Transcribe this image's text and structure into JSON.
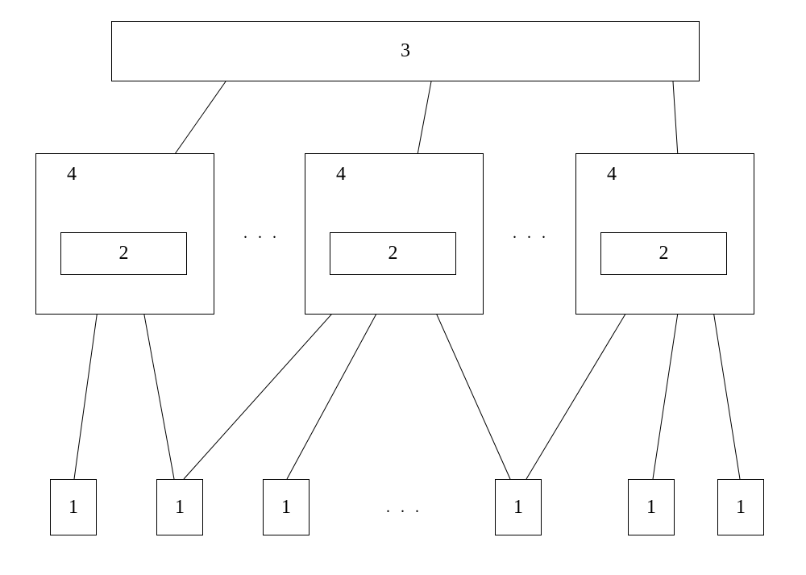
{
  "chart_data": {
    "type": "diagram",
    "title": "",
    "description": "Hierarchical tree / network diagram with three levels",
    "nodes": [
      {
        "id": "top",
        "label": "3",
        "level": 0
      },
      {
        "id": "container_a",
        "label": "4",
        "level": 1
      },
      {
        "id": "container_b",
        "label": "4",
        "level": 1
      },
      {
        "id": "container_c",
        "label": "4",
        "level": 1
      },
      {
        "id": "inner_a",
        "label": "2",
        "level": 1,
        "parent": "container_a"
      },
      {
        "id": "inner_b",
        "label": "2",
        "level": 1,
        "parent": "container_b"
      },
      {
        "id": "inner_c",
        "label": "2",
        "level": 1,
        "parent": "container_c"
      },
      {
        "id": "leaf_1",
        "label": "1",
        "level": 2
      },
      {
        "id": "leaf_2",
        "label": "1",
        "level": 2
      },
      {
        "id": "leaf_3",
        "label": "1",
        "level": 2
      },
      {
        "id": "leaf_4",
        "label": "1",
        "level": 2
      },
      {
        "id": "leaf_5",
        "label": "1",
        "level": 2
      },
      {
        "id": "leaf_6",
        "label": "1",
        "level": 2
      }
    ],
    "edges": [
      {
        "from": "top",
        "to": "inner_a"
      },
      {
        "from": "top",
        "to": "inner_b"
      },
      {
        "from": "top",
        "to": "inner_c"
      },
      {
        "from": "inner_a",
        "to": "leaf_1"
      },
      {
        "from": "inner_a",
        "to": "leaf_2"
      },
      {
        "from": "inner_b",
        "to": "leaf_2"
      },
      {
        "from": "inner_b",
        "to": "leaf_3"
      },
      {
        "from": "inner_b",
        "to": "leaf_4"
      },
      {
        "from": "inner_c",
        "to": "leaf_4"
      },
      {
        "from": "inner_c",
        "to": "leaf_5"
      },
      {
        "from": "inner_c",
        "to": "leaf_6"
      }
    ],
    "ellipses": [
      {
        "between": [
          "container_a",
          "container_b"
        ]
      },
      {
        "between": [
          "container_b",
          "container_c"
        ]
      },
      {
        "between": [
          "leaf_3",
          "leaf_4"
        ]
      }
    ]
  },
  "labels": {
    "top": "3",
    "container_a": "4",
    "container_b": "4",
    "container_c": "4",
    "inner_a": "2",
    "inner_b": "2",
    "inner_c": "2",
    "leaf_1": "1",
    "leaf_2": "1",
    "leaf_3": "1",
    "leaf_4": "1",
    "leaf_5": "1",
    "leaf_6": "1",
    "dots": ". . ."
  }
}
